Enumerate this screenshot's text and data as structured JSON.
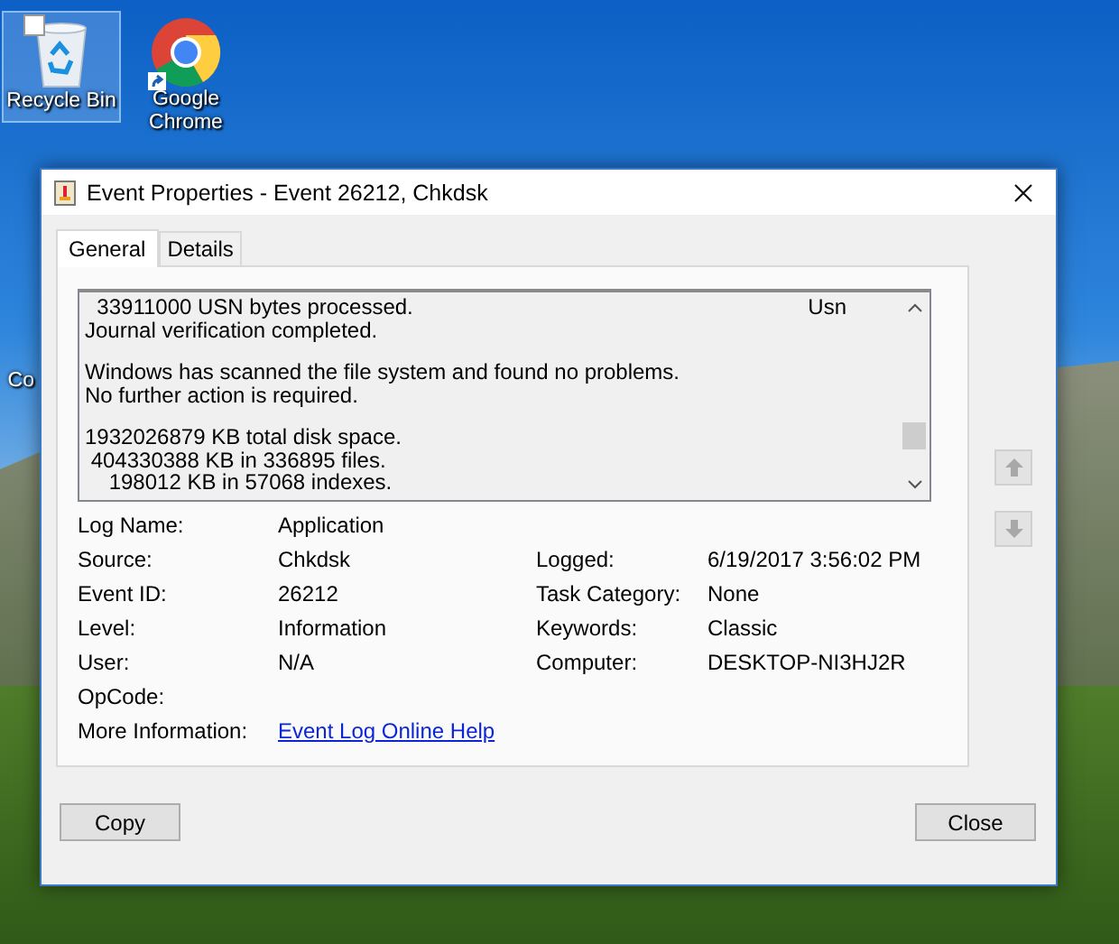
{
  "desktop_icons": [
    {
      "kind": "recycle",
      "label": "Recycle Bin",
      "selected": true
    },
    {
      "kind": "chrome",
      "label": "Google Chrome",
      "selected": false
    },
    {
      "kind": "partial",
      "label": "Co",
      "selected": false
    }
  ],
  "window": {
    "title": "Event Properties - Event 26212, Chkdsk",
    "tabs": [
      {
        "label": "General",
        "selected": true
      },
      {
        "label": "Details",
        "selected": false
      }
    ],
    "description": [
      [
        {
          "text": "  33911000 USN bytes processed.",
          "tail": "Usn"
        },
        {
          "text": "Journal verification completed."
        }
      ],
      [
        {
          "text": "Windows has scanned the file system and found no problems."
        },
        {
          "text": "No further action is required."
        }
      ],
      [
        {
          "text": "1932026879 KB total disk space."
        },
        {
          "text": " 404330388 KB in 336895 files."
        },
        {
          "text": "    198012 KB in 57068 indexes."
        }
      ]
    ],
    "rows": [
      {
        "left": {
          "label": "Log Name:",
          "value": "Application"
        }
      },
      {
        "left": {
          "label": "Source:",
          "value": "Chkdsk"
        },
        "right": {
          "label": "Logged:",
          "value": "6/19/2017 3:56:02 PM"
        }
      },
      {
        "left": {
          "label": "Event ID:",
          "value": "26212"
        },
        "right": {
          "label": "Task Category:",
          "value": "None"
        }
      },
      {
        "left": {
          "label": "Level:",
          "value": "Information"
        },
        "right": {
          "label": "Keywords:",
          "value": "Classic"
        }
      },
      {
        "left": {
          "label": "User:",
          "value": "N/A"
        },
        "right": {
          "label": "Computer:",
          "value": "DESKTOP-NI3HJ2R"
        }
      },
      {
        "left": {
          "label": "OpCode:"
        }
      },
      {
        "left": {
          "label": "More Information:",
          "value": "Event Log Online Help",
          "kind": "link"
        }
      }
    ],
    "nav_buttons": [
      {
        "kind": "up",
        "disabled": true
      },
      {
        "kind": "down",
        "disabled": true
      }
    ],
    "buttons": [
      "Copy",
      "Close"
    ]
  }
}
